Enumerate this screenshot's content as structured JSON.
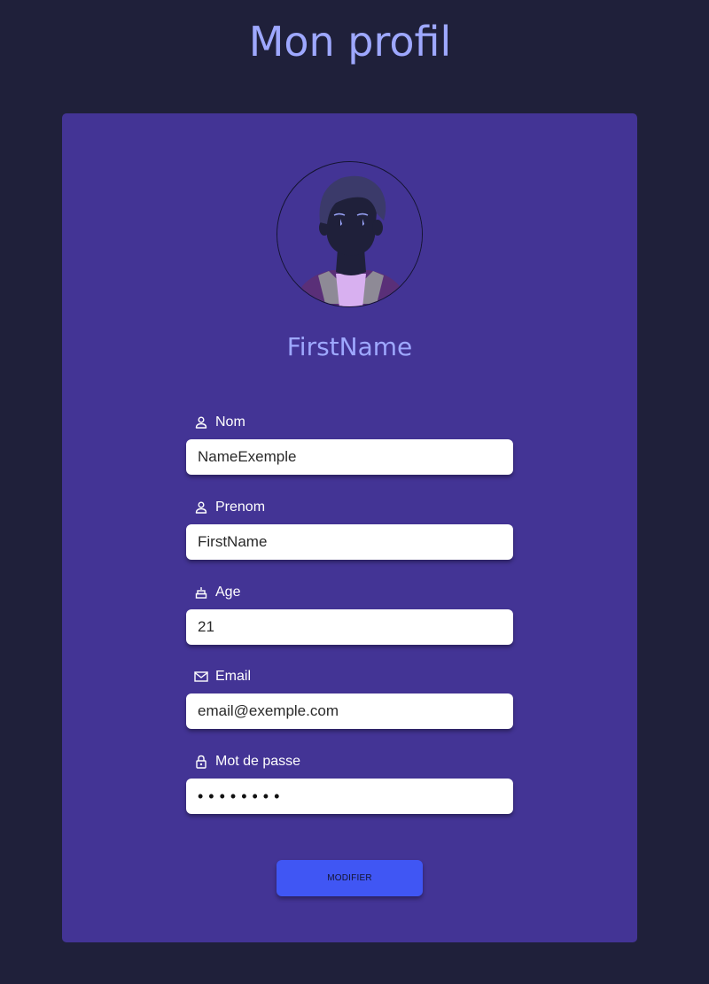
{
  "header": {
    "title": "Mon profil"
  },
  "profile": {
    "display_name": "FirstName",
    "avatar_icon": "user-avatar-illustration"
  },
  "form": {
    "fields": [
      {
        "label": "Nom",
        "icon": "user-icon",
        "value": "NameExemple",
        "type": "text"
      },
      {
        "label": "Prenom",
        "icon": "user-icon",
        "value": "FirstName",
        "type": "text"
      },
      {
        "label": "Age",
        "icon": "cake-icon",
        "value": "21",
        "type": "text"
      },
      {
        "label": "Email",
        "icon": "mail-icon",
        "value": "email@exemple.com",
        "type": "email"
      },
      {
        "label": "Mot de passe",
        "icon": "lock-icon",
        "value": "••••••••",
        "type": "password"
      }
    ],
    "submit_label": "MODIFIER"
  },
  "colors": {
    "background": "#1f203a",
    "card": "#433495",
    "accent_text": "#9ea8ff",
    "button": "#4056f4"
  }
}
